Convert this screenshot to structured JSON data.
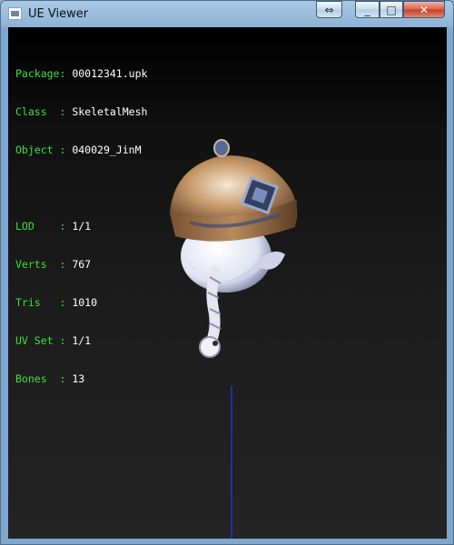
{
  "window": {
    "title": "UE Viewer",
    "buttons": {
      "resize": "⇔",
      "minimize": "_",
      "maximize": "□",
      "close": "✕"
    }
  },
  "info": {
    "package": {
      "label": "Package:",
      "value": "00012341.upk"
    },
    "class": {
      "label": "Class  :",
      "value": "SkeletalMesh"
    },
    "object": {
      "label": "Object :",
      "value": "040029_JinM"
    },
    "lod": {
      "label": "LOD    :",
      "value": "1/1"
    },
    "verts": {
      "label": "Verts  :",
      "value": "767"
    },
    "tris": {
      "label": "Tris   :",
      "value": "1010"
    },
    "uvset": {
      "label": "UV Set :",
      "value": "1/1"
    },
    "bones": {
      "label": "Bones  :",
      "value": "13"
    }
  },
  "colors": {
    "label": "#3ee03e",
    "value": "#ffffff",
    "axis": "#1b2fb0"
  }
}
